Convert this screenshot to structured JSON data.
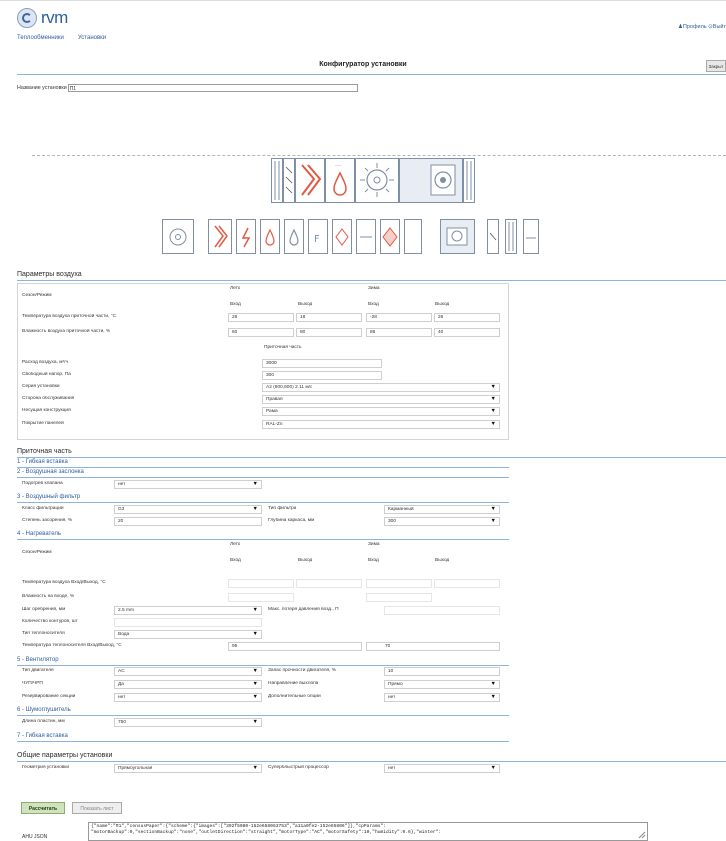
{
  "header": {
    "logo_text": "rvm",
    "nav": [
      "Теплообменники",
      "Установки"
    ],
    "user_links": "♟Профиль  ⊙Выйт",
    "title": "Конфигуратор установки",
    "close_label": "Закрыт"
  },
  "name_field": {
    "label": "Название установки",
    "value": "П1"
  },
  "air": {
    "heading": "Параметры воздуха",
    "season_label": "Сезон/Режим",
    "summer": "Лето",
    "winter": "Зима",
    "in": "Вход",
    "out": "Выход",
    "rows": [
      {
        "label": "Температура воздуха приточной части, °С",
        "v": [
          "26",
          "18",
          "-28",
          "26"
        ]
      },
      {
        "label": "Влажность воздуха приточной части, %",
        "v": [
          "60",
          "80",
          "86",
          "40"
        ]
      }
    ],
    "supply_part": "Приточная часть",
    "params": [
      {
        "label": "Расход воздуха, м³/ч",
        "value": "3000",
        "select": false
      },
      {
        "label": "Свободный напор, Па",
        "value": "300",
        "select": false
      },
      {
        "label": "Серия установки",
        "value": "A2 (900,600) 2.11 м/с",
        "select": true
      },
      {
        "label": "Сторона обслуживания",
        "value": "Правая",
        "select": true
      },
      {
        "label": "Несущая конструкция",
        "value": "Рама",
        "select": true
      },
      {
        "label": "Покрытие панелей",
        "value": "RAL-Zn",
        "select": true
      }
    ]
  },
  "supply": {
    "heading": "Приточная часть",
    "s1": "1 - Гибкая вставка",
    "s2": "2 - Воздушная заслонка",
    "heat_valve_label": "Подогрев клапана",
    "heat_valve_value": "нет",
    "s3": "3 - Воздушный фильтр",
    "filter_class_label": "Класс фильтрации",
    "filter_class_value": "G3",
    "filter_type_label": "Тип фильтра",
    "filter_type_value": "Карманный",
    "clog_label": "Степень засорения, %",
    "clog_value": "20",
    "frame_depth_label": "Глубина каркаса, мм",
    "frame_depth_value": "300",
    "s4": "4 - Нагреватель",
    "season_label": "Сезон/Режим",
    "summer": "Лето",
    "winter": "Зима",
    "in": "Вход",
    "out": "Выход",
    "air_temp_label": "Температура воздуха Вход/Выход, °С",
    "humidity_label": "Влажность на входе, %",
    "fin_step_label": "Шаг оребрения, мм",
    "fin_step_value": "2.5 mm",
    "max_loss_label": "Макс. потеря давления возд., П",
    "circuits_label": "Количество контуров, шт",
    "coolant_type_label": "Тип теплоносителя",
    "coolant_type_value": "Вода",
    "coolant_temp_label": "Температура теплоносителя Вход/Выход, °С",
    "coolant_in": "95",
    "coolant_out": "70",
    "s5": "5 - Вентилятор",
    "motor_type_label": "Тип двигателя",
    "motor_type_value": "AC",
    "motor_margin_label": "Запас прочности двигателя, %",
    "motor_margin_value": "10",
    "chp_label": "ЧУП/ЧРП",
    "chp_value": "Да",
    "exhaust_dir_label": "Направление выхлопа",
    "exhaust_dir_value": "Прямо",
    "backup_label": "Резервирование секции",
    "backup_value": "нет",
    "extra_label": "Дополнительные опции",
    "extra_value": "нет",
    "s6": "6 - Шумоглушитель",
    "plate_len_label": "Длина пластин, мм",
    "plate_len_value": "750",
    "s7": "7 - Гибкая вставка"
  },
  "general": {
    "heading": "Общие параметры установки",
    "geometry_label": "Геометрия установки",
    "geometry_value": "Прямоугольная",
    "cpu_label": "Суперблыстрый процессор",
    "cpu_value": "нет",
    "calc_label": "Рассчитать",
    "show_label": "Показать лист",
    "json_label": "AHU JSON",
    "json_line1": "{\"name\":\"П1\",\"censusPaper\":{\"scheme\":{\"images\":[\"392f5080-152e658063753\",\"a11a0fe2-152e65806\"]},\"cpParams\":",
    "json_line2": "\"motorBackup\":0,\"sectionBackup\":\"none\",\"outletDirection\":\"straight\",\"motorType\":\"AC\",\"motorSafety\":10,\"humidity\":0.6},\"winter\":"
  },
  "colors": {
    "accent": "#2f5f9c",
    "rule": "#8db3df",
    "section_icon": "#e05a44"
  }
}
